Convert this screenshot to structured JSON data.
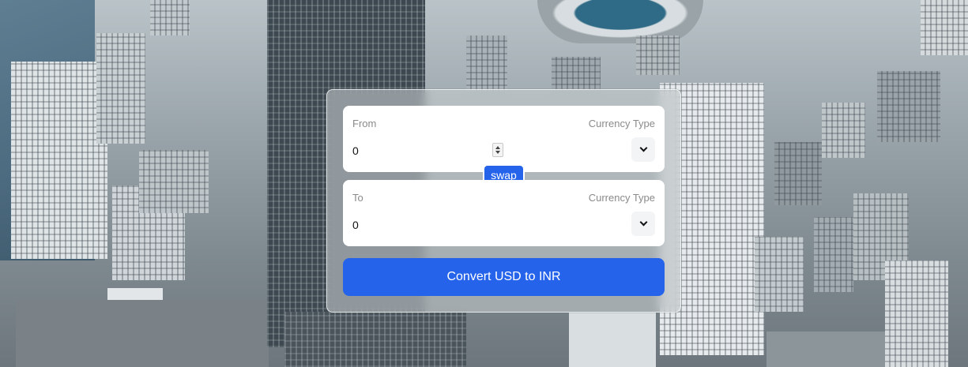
{
  "converter": {
    "from": {
      "label": "From",
      "currency_label": "Currency Type",
      "amount": "0",
      "selected_currency": "usd"
    },
    "to": {
      "label": "To",
      "currency_label": "Currency Type",
      "amount": "0",
      "selected_currency": "inr"
    },
    "swap_label": "swap",
    "convert_label": "Convert USD to INR"
  },
  "colors": {
    "accent": "#2563eb",
    "panel": "#ffffff",
    "label_text": "#8a8a8a"
  },
  "icons": {
    "select_chevron": "chevron-down-icon",
    "number_spinner": "spinner-icon"
  }
}
